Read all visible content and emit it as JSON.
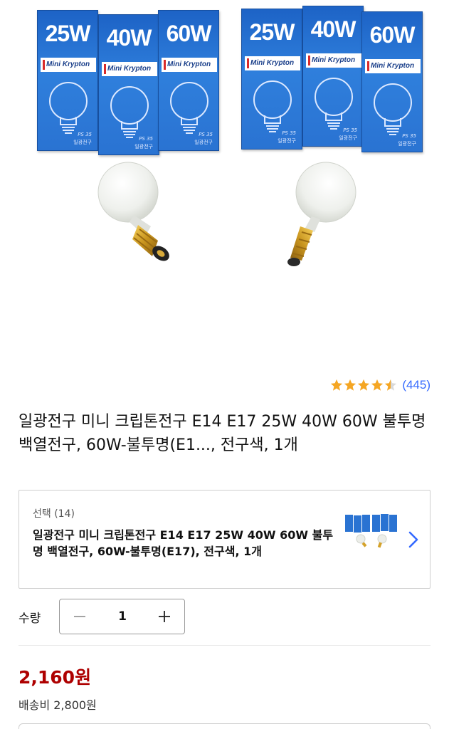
{
  "product_image": {
    "boxes_left": [
      {
        "watt": "25W",
        "brand": "Mini Krypton",
        "spec": "PS 35",
        "maker": "일광전구"
      },
      {
        "watt": "40W",
        "brand": "Mini Krypton",
        "spec": "PS 35",
        "maker": "일광전구"
      },
      {
        "watt": "60W",
        "brand": "Mini Krypton",
        "spec": "PS 35",
        "maker": "일광전구"
      }
    ],
    "boxes_right": [
      {
        "watt": "25W",
        "brand": "Mini Krypton",
        "spec": "PS 35",
        "maker": "일광전구"
      },
      {
        "watt": "40W",
        "brand": "Mini Krypton",
        "spec": "PS 35",
        "maker": "일광전구"
      },
      {
        "watt": "60W",
        "brand": "Mini Krypton",
        "spec": "PS 35",
        "maker": "일광전구"
      }
    ]
  },
  "rating": {
    "stars": 4.5,
    "review_count": "(445)"
  },
  "title": "일광전구 미니 크립톤전구 E14 E17 25W 40W 60W 불투명 백열전구, 60W-불투명(E1..., 전구색, 1개",
  "option": {
    "label": "선택 (14)",
    "selected_text": "일광전구 미니 크립톤전구 E14 E17 25W 40W 60W 불투명 백열전구, 60W-불투명(E17), 전구색, 1개"
  },
  "quantity": {
    "label": "수량",
    "value": "1",
    "minus": "−",
    "plus": "+"
  },
  "price": {
    "amount": "2,160원",
    "shipping": "배송비 2,800원"
  },
  "colors": {
    "accent_link": "#346aff",
    "price": "#ae0000",
    "star": "#f5a623",
    "box_blue": "#2a73d2"
  }
}
